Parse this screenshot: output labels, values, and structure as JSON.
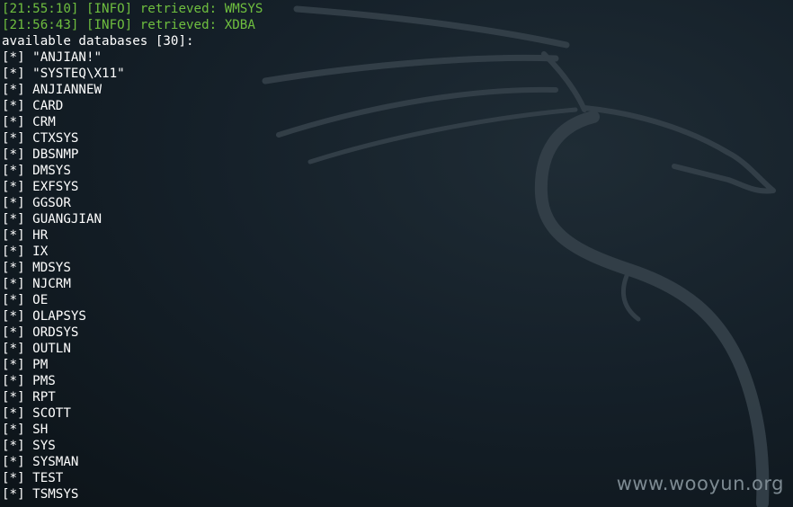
{
  "terminal": {
    "log_lines": [
      "[21:55:10] [INFO] retrieved: WMSYS",
      "[21:56:43] [INFO] retrieved: XDBA"
    ],
    "header": "available databases [30]:",
    "bullet": "[*]",
    "databases": [
      "\"ANJIAN!\"",
      "\"SYSTEQ\\X11\"",
      "ANJIANNEW",
      "CARD",
      "CRM",
      "CTXSYS",
      "DBSNMP",
      "DMSYS",
      "EXFSYS",
      "GGSOR",
      "GUANGJIAN",
      "HR",
      "IX",
      "MDSYS",
      "NJCRM",
      "OE",
      "OLAPSYS",
      "ORDSYS",
      "OUTLN",
      "PM",
      "PMS",
      "RPT",
      "SCOTT",
      "SH",
      "SYS",
      "SYSMAN",
      "TEST",
      "TSMSYS"
    ]
  },
  "watermark": "www.wooyun.org",
  "colors": {
    "log_green": "#6fbf3f",
    "text_white": "#ffffff",
    "background_dark": "#152029"
  },
  "icons": {
    "background": "kali-dragon-icon"
  }
}
